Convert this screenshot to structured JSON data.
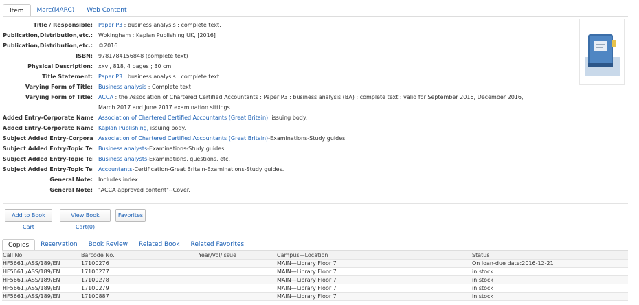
{
  "top_tabs": [
    "Item",
    "Marc(MARC)",
    "Web Content"
  ],
  "records": [
    {
      "label": "Title / Responsible:",
      "link": "Paper P3",
      "text": " : business analysis : complete text."
    },
    {
      "label": "Publication,Distribution,etc.:",
      "link": "",
      "text": "Wokingham : Kaplan Publishing UK, [2016]"
    },
    {
      "label": "Publication,Distribution,etc.:",
      "link": "",
      "text": "©2016"
    },
    {
      "label": "ISBN:",
      "link": "",
      "text": "9781784156848 (complete text)"
    },
    {
      "label": "Physical Description:",
      "link": "",
      "text": "xxvi, 818, 4 pages ; 30 cm"
    },
    {
      "label": "Title Statement:",
      "link": "Paper P3",
      "text": " : business analysis : complete text."
    },
    {
      "label": "Varying Form of Title:",
      "link": "Business analysis",
      "text": " : Complete text"
    },
    {
      "label": "Varying Form of Title:",
      "link": "ACCA",
      "text": " : the Association of Chartered Certified Accountants : Paper P3 : business analysis (BA) : complete text : valid for September 2016, December 2016, March 2017 and June 2017 examination sittings"
    },
    {
      "label": "Added Entry-Corporate Name:",
      "link": "Association of Chartered Certified Accountants (Great Britain)",
      "text": ", issuing body."
    },
    {
      "label": "Added Entry-Corporate Name:",
      "link": "Kaplan Publishing,",
      "text": " issuing body."
    },
    {
      "label": "Subject Added Entry-Corporate",
      "link": "Association of Chartered Certified Accountants (Great Britain)",
      "text": "-Examinations-Study guides."
    },
    {
      "label": "Subject Added Entry-Topic Term:",
      "link": "Business analysts",
      "text": "-Examinations-Study guides."
    },
    {
      "label": "Subject Added Entry-Topic Term:",
      "link": "Business analysts",
      "text": "-Examinations, questions, etc."
    },
    {
      "label": "Subject Added Entry-Topic Term:",
      "link": "Accountants",
      "text": "-Certification-Great Britain-Examinations-Study guides."
    },
    {
      "label": "General Note:",
      "link": "",
      "text": "Includes index."
    },
    {
      "label": "General Note:",
      "link": "",
      "text": "\"ACCA approved content\"--Cover."
    }
  ],
  "buttons": {
    "add_cart": "Add to Book Cart",
    "view_cart": "View Book Cart(0)",
    "favorites": "Favorites"
  },
  "bottom_tabs": [
    "Copies",
    "Reservation",
    "Book Review",
    "Related Book",
    "Related Favorites"
  ],
  "copies": {
    "headers": [
      "Call No.",
      "Barcode No.",
      "Year/Vol/Issue",
      "Campus—Location",
      "Status"
    ],
    "rows": [
      [
        "HF5661./ASS/189/EN",
        "17100276",
        "",
        "MAIN—Library Floor 7",
        "On loan-due date:2016-12-21"
      ],
      [
        "HF5661./ASS/189/EN",
        "17100277",
        "",
        "MAIN—Library Floor 7",
        "in stock"
      ],
      [
        "HF5661./ASS/189/EN",
        "17100278",
        "",
        "MAIN—Library Floor 7",
        "in stock"
      ],
      [
        "HF5661./ASS/189/EN",
        "17100279",
        "",
        "MAIN—Library Floor 7",
        "in stock"
      ],
      [
        "HF5661./ASS/189/EN",
        "17100887",
        "",
        "MAIN—Library Floor 7",
        "in stock"
      ]
    ]
  },
  "colors": {
    "link": "#1a5fb4",
    "in_stock": "#2e8b2e"
  },
  "cover": {
    "icon": "book-cover-icon"
  }
}
